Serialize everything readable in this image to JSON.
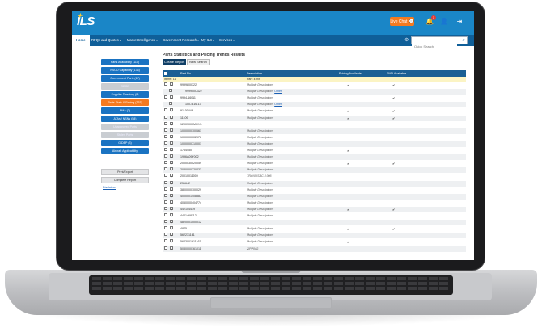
{
  "app": {
    "logo": "ILS",
    "live_chat": "Live Chat",
    "notification_count": "1"
  },
  "nav": {
    "items": [
      "Home",
      "RFQs and Quotes",
      "Market Intelligence",
      "Government Research",
      "My ILS",
      "Services"
    ],
    "search_placeholder": "Quick Search"
  },
  "sidebar": {
    "items": [
      {
        "label": "Parts Availability (110)",
        "state": "normal"
      },
      {
        "label": "NSCO Capability (138)",
        "state": "normal"
      },
      {
        "label": "Government Parts (67)",
        "state": "normal"
      },
      {
        "label": "ODGE",
        "state": "disabled"
      },
      {
        "label": "Supplier Directory (8)",
        "state": "normal"
      },
      {
        "label": "Parts Stats & Pricing (363)",
        "state": "active"
      },
      {
        "label": "PMA (2)",
        "state": "normal"
      },
      {
        "label": "ATAs / NSNs (58)",
        "state": "normal"
      },
      {
        "label": "Unapproved Parts",
        "state": "disabled"
      },
      {
        "label": "Stolen Parts",
        "state": "disabled"
      },
      {
        "label": "GIDEP (3)",
        "state": "normal"
      },
      {
        "label": "Aircraft Applicability",
        "state": "normal"
      }
    ],
    "tools": [
      "Print/Export",
      "Complete Report"
    ],
    "disclaimer": "Disclaimer"
  },
  "main": {
    "title": "Parts Statistics and Pricing Trends Results",
    "create_button": "Create Report",
    "new_search_button": "New Search",
    "columns": [
      "Part No.",
      "Description",
      "Pricing Available",
      "FMV Available"
    ],
    "items_label": "Items: 11",
    "items_part": "Part: z.lnlt",
    "rows": [
      {
        "part": "9999800322",
        "desc": "Multiple Descriptions",
        "other": "",
        "pricing": "✔",
        "fmv": "✔",
        "sub": false
      },
      {
        "part": "999900C322",
        "desc": "Multiple Descriptions",
        "other": "Other",
        "pricing": "",
        "fmv": "",
        "sub": true
      },
      {
        "part": "9994-16011",
        "desc": "Multiple Descriptions",
        "other": "",
        "pricing": "",
        "fmv": "✔",
        "sub": false
      },
      {
        "part": "100-4-16-13",
        "desc": "Multiple Descriptions",
        "other": "Other",
        "pricing": "",
        "fmv": "",
        "sub": true
      },
      {
        "part": "91100448",
        "desc": "Multiple Descriptions",
        "other": "",
        "pricing": "✔",
        "fmv": "✔",
        "sub": false
      },
      {
        "part": "11109",
        "desc": "Multiple Descriptions",
        "other": "",
        "pricing": "✔",
        "fmv": "✔",
        "sub": false
      },
      {
        "part": "12007000MIXXL",
        "desc": "",
        "other": "",
        "pricing": "",
        "fmv": "",
        "sub": false
      },
      {
        "part": "1000000100661",
        "desc": "Multiple Descriptions",
        "other": "",
        "pricing": "",
        "fmv": "",
        "sub": false
      },
      {
        "part": "1000000002976",
        "desc": "Multiple Descriptions",
        "other": "",
        "pricing": "",
        "fmv": "",
        "sub": false
      },
      {
        "part": "1000000710001",
        "desc": "Multiple Descriptions",
        "other": "",
        "pricing": "",
        "fmv": "",
        "sub": false
      },
      {
        "part": "1764450",
        "desc": "Multiple Descriptions",
        "other": "",
        "pricing": "✔",
        "fmv": "",
        "sub": false
      },
      {
        "part": "1996A09F002",
        "desc": "Multiple Descriptions",
        "other": "",
        "pricing": "",
        "fmv": "",
        "sub": false
      },
      {
        "part": "2000030020059",
        "desc": "Multiple Descriptions",
        "other": "",
        "pricing": "✔",
        "fmv": "✔",
        "sub": false
      },
      {
        "part": "2030000220233",
        "desc": "Multiple Descriptions",
        "other": "",
        "pricing": "",
        "fmv": "",
        "sub": false
      },
      {
        "part": "20010011009",
        "desc": "TRANSISBC.4.006",
        "other": "",
        "pricing": "",
        "fmv": "",
        "sub": false
      },
      {
        "part": "251642",
        "desc": "Multiple Descriptions",
        "other": "",
        "pricing": "",
        "fmv": "",
        "sub": false
      },
      {
        "part": "3800000100029",
        "desc": "Multiple Descriptions",
        "other": "",
        "pricing": "",
        "fmv": "",
        "sub": false
      },
      {
        "part": "4000001408887",
        "desc": "Multiple Descriptions",
        "other": "",
        "pricing": "",
        "fmv": "",
        "sub": false
      },
      {
        "part": "4050000404774",
        "desc": "Multiple Descriptions",
        "other": "",
        "pricing": "",
        "fmv": "",
        "sub": false
      },
      {
        "part": "442104419",
        "desc": "Multiple Descriptions",
        "other": "",
        "pricing": "✔",
        "fmv": "✔",
        "sub": false
      },
      {
        "part": "4421468112",
        "desc": "Multiple Descriptions",
        "other": "",
        "pricing": "",
        "fmv": "",
        "sub": false
      },
      {
        "part": "4820001000012",
        "desc": "",
        "other": "",
        "pricing": "",
        "fmv": "",
        "sub": false
      },
      {
        "part": "4875",
        "desc": "Multiple Descriptions",
        "other": "",
        "pricing": "✔",
        "fmv": "✔",
        "sub": false
      },
      {
        "part": "562231161",
        "desc": "Multiple Descriptions",
        "other": "",
        "pricing": "",
        "fmv": "",
        "sub": false
      },
      {
        "part": "5643001611167",
        "desc": "Multiple Descriptions",
        "other": "",
        "pricing": "✔",
        "fmv": "",
        "sub": false
      },
      {
        "part": "5030000161011",
        "desc": "ZIPPING",
        "other": "",
        "pricing": "",
        "fmv": "",
        "sub": false
      }
    ]
  }
}
